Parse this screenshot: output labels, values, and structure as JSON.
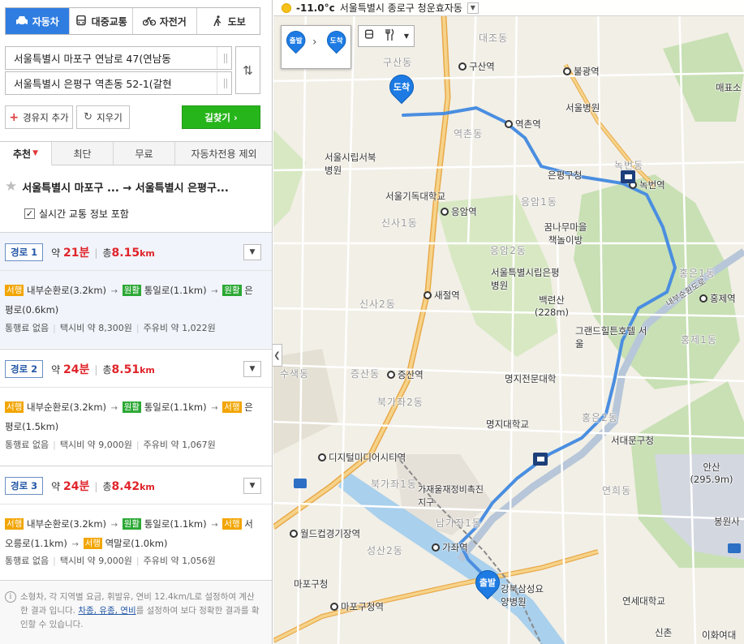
{
  "modes": [
    {
      "label": "자동차",
      "icon": "car-icon",
      "active": true
    },
    {
      "label": "대중교통",
      "icon": "bus-icon",
      "active": false
    },
    {
      "label": "자전거",
      "icon": "bicycle-icon",
      "active": false
    },
    {
      "label": "도보",
      "icon": "walk-icon",
      "active": false
    }
  ],
  "start_address": "서울특별시 마포구 연남로 47(연남동",
  "end_address": "서울특별시 은평구 역촌동 52-1(갈현",
  "buttons": {
    "add_waypoint": "경유지 추가",
    "clear": "지우기",
    "search": "길찾기 ›"
  },
  "sort_tabs": [
    "추천",
    "최단",
    "무료",
    "자동차전용 제외"
  ],
  "route_header": "서울특별시 마포구 ... → 서울특별시 은평구...",
  "realtime_label": "실시간 교통 정보 포함",
  "routes": [
    {
      "badge": "경로 1",
      "time_prefix": "약",
      "time": "21분",
      "dist_prefix": "총",
      "dist": "8.15",
      "dist_unit": "km",
      "segments": [
        {
          "tag": "서행",
          "color": "y",
          "road": "내부순환로(3.2km)"
        },
        {
          "tag": "원활",
          "color": "g",
          "road": "통일로(1.1km)"
        },
        {
          "tag": "원활",
          "color": "g",
          "road": "은평로(0.6km)"
        }
      ],
      "toll": "통행료 없음",
      "taxi": "택시비 약 8,300원",
      "fuel": "주유비 약 1,022원"
    },
    {
      "badge": "경로 2",
      "time_prefix": "약",
      "time": "24분",
      "dist_prefix": "총",
      "dist": "8.51",
      "dist_unit": "km",
      "segments": [
        {
          "tag": "서행",
          "color": "y",
          "road": "내부순환로(3.2km)"
        },
        {
          "tag": "원활",
          "color": "g",
          "road": "통일로(1.1km)"
        },
        {
          "tag": "서행",
          "color": "y",
          "road": "은평로(1.5km)"
        }
      ],
      "toll": "통행료 없음",
      "taxi": "택시비 약 9,000원",
      "fuel": "주유비 약 1,067원"
    },
    {
      "badge": "경로 3",
      "time_prefix": "약",
      "time": "24분",
      "dist_prefix": "총",
      "dist": "8.42",
      "dist_unit": "km",
      "segments": [
        {
          "tag": "서행",
          "color": "y",
          "road": "내부순환로(3.2km)"
        },
        {
          "tag": "원활",
          "color": "g",
          "road": "통일로(1.1km)"
        },
        {
          "tag": "서행",
          "color": "y",
          "road": "서오릉로(1.1km)"
        },
        {
          "tag": "서행",
          "color": "y",
          "road": "역말로(1.0km)"
        }
      ],
      "toll": "통행료 없음",
      "taxi": "택시비 약 9,000원",
      "fuel": "주유비 약 1,056원"
    }
  ],
  "note": {
    "before": "소형차, 각 지역별 요금, 휘발유, 연비 12.4km/L로 설정하여 계산한 결과 입니다. ",
    "link": "차종, 유종, 연비",
    "after": "를 설정하여 보다 정확한 결과를 확인할 수 있습니다."
  },
  "weather": {
    "temp": "-11.0°c",
    "location": "서울특별시 종로구 청운효자동"
  },
  "pins": {
    "start": "출발",
    "end": "도착"
  },
  "map_labels": {
    "dongs": [
      "대조동",
      "구산동",
      "역촌동",
      "녹번동",
      "응암1동",
      "응암2동",
      "신사1동",
      "신사2동",
      "홍은1동",
      "홍제1동",
      "홍제1동",
      "수색동",
      "증산동",
      "북가좌2동",
      "북가좌1동",
      "남가좌1동",
      "홍은2동",
      "연희동",
      "성산2동",
      "가재울재정비촉진지구"
    ],
    "stations": [
      "구산역",
      "불광역",
      "역촌역",
      "녹번역",
      "응암역",
      "새절역",
      "증산역",
      "홍제역",
      "디지털미디어시티역",
      "월드컵경기장역",
      "가좌역",
      "마포구청역"
    ],
    "places": [
      "서울병원",
      "서울시립서북병원",
      "서울기독대학교",
      "꿈나무마을 책놀이방",
      "서울특별시립은평병원",
      "은평구청",
      "그랜드힐튼호텔 서울",
      "명지전문대학",
      "명지대학교",
      "서대문구청",
      "마포구청",
      "강북삼성요양병원",
      "연세대학교",
      "신촌",
      "이화여대",
      "봉원사",
      "백련산 (228m)",
      "안산 (295.9m)",
      "매표소"
    ],
    "road": "내부순환도로"
  },
  "colors": {
    "accent": "#2f7de1",
    "search": "#27b51c",
    "route": "#4a8ee0",
    "slow": "#f2a500",
    "smooth": "#2ba834"
  }
}
